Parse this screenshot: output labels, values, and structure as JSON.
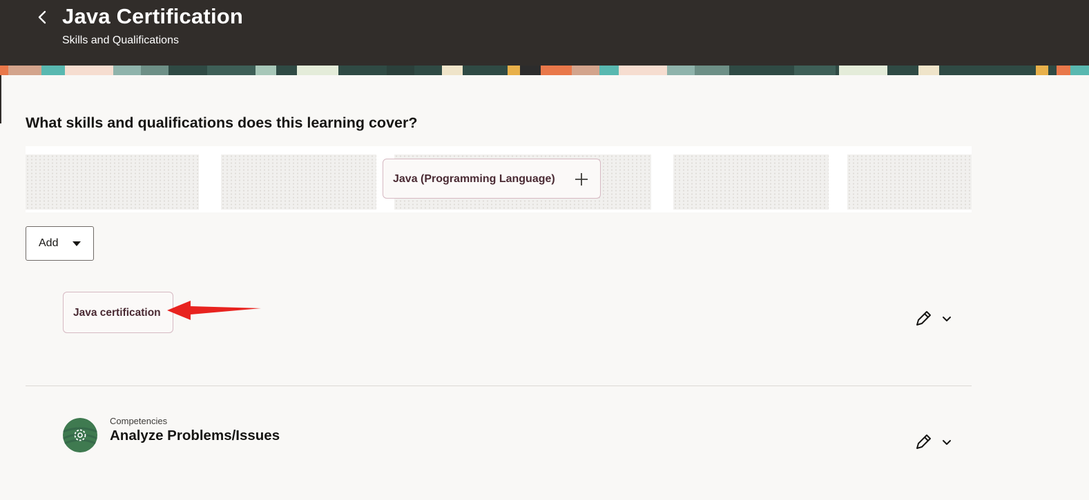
{
  "header": {
    "title": "Java Certification",
    "subtitle": "Skills and Qualifications",
    "back_icon": "chevron-left-icon"
  },
  "main": {
    "question": "What skills and qualifications does this learning cover?",
    "suggestion": {
      "label": "Java (Programming Language)",
      "icon": "plus-icon"
    },
    "add_button": {
      "label": "Add",
      "icon": "caret-down-icon"
    },
    "items": [
      {
        "label": "Java certification",
        "edit_icon": "pencil-icon",
        "expand_icon": "chevron-down-icon"
      },
      {
        "category": "Competencies",
        "name": "Analyze Problems/Issues",
        "avatar_icon": "competency-gear-icon",
        "edit_icon": "pencil-icon",
        "expand_icon": "chevron-down-icon"
      }
    ]
  },
  "colors": {
    "header_bg": "#312d2a",
    "page_bg": "#f9f8f6",
    "chip_border": "#d6b9c2",
    "chip_text": "#4a2a33",
    "annotation_arrow": "#e8231f",
    "avatar_green": "#3f7a50"
  }
}
